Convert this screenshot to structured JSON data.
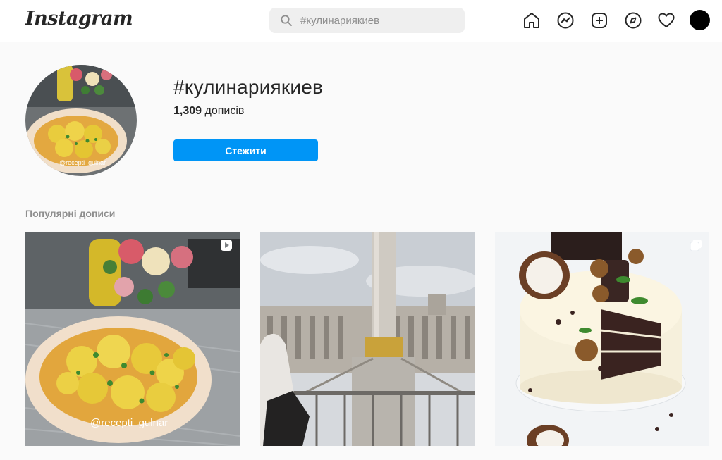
{
  "header": {
    "logo_text": "Instagram",
    "search": {
      "placeholder": "#кулинариякиев"
    },
    "icons": [
      "home-icon",
      "messenger-icon",
      "new-post-icon",
      "explore-icon",
      "activity-heart-icon",
      "profile-avatar"
    ]
  },
  "tag": {
    "title": "#кулинариякиев",
    "posts_count": "1,309",
    "posts_suffix": " дописів",
    "follow_label": "Стежити",
    "profile_watermark": "@recepti_gulnar"
  },
  "section": {
    "label": "Популярні дописи"
  },
  "posts": [
    {
      "type": "video",
      "badge": "video-icon",
      "watermark": "@recepti_gulnar"
    },
    {
      "type": "photo"
    },
    {
      "type": "carousel",
      "badge": "carousel-icon"
    }
  ],
  "colors": {
    "accent": "#0095f6",
    "background": "#fafafa",
    "text": "#262626",
    "muted": "#8e8e8e"
  }
}
